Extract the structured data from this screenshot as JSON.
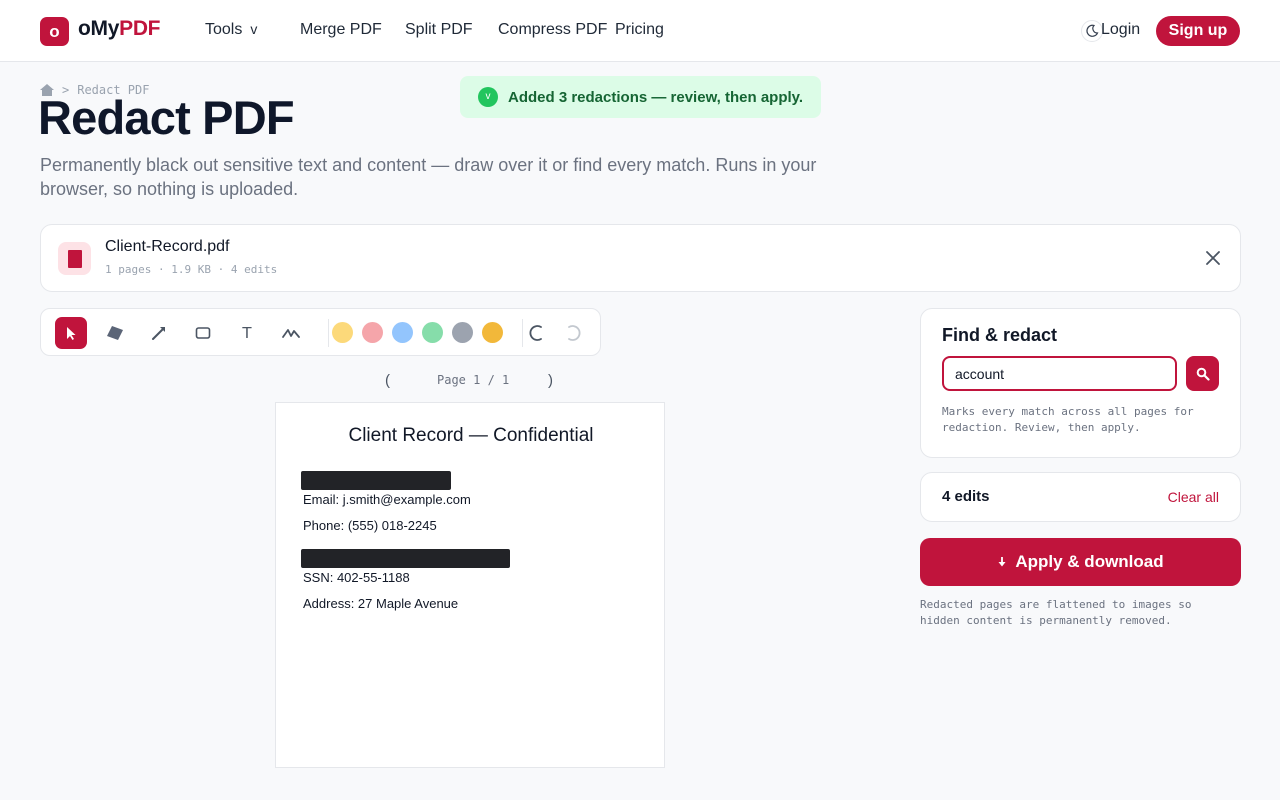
{
  "header": {
    "logo_letter": "o",
    "logo_part1": "oMy",
    "logo_part2": "PDF",
    "nav": {
      "tools": "Tools",
      "tools_chevron": "v",
      "merge": "Merge PDF",
      "split": "Split PDF",
      "compress": "Compress PDF",
      "pricing": "Pricing"
    },
    "login": "Login",
    "signup": "Sign up"
  },
  "breadcrumb": {
    "separator": ">",
    "current": "Redact PDF"
  },
  "page": {
    "title": "Redact PDF",
    "subtitle": "Permanently black out sensitive text and content — draw over it or find every match. Runs in your browser, so nothing is uploaded."
  },
  "toast": {
    "icon": "v",
    "message": "Added 3 redactions — review, then apply."
  },
  "file": {
    "name": "Client-Record.pdf",
    "meta": "1 pages · 1.9 KB · 4 edits"
  },
  "toolbar": {
    "tools": [
      "select-tool",
      "eraser-tool",
      "arrow-tool",
      "rectangle-tool",
      "text-tool",
      "freehand-tool"
    ],
    "text_tool_glyph": "T",
    "colors": [
      "#fcd97a",
      "#f5a5aa",
      "#93c5fd",
      "#86ddaa",
      "#9ca3af",
      "#f2b83a"
    ]
  },
  "pager": {
    "prev": "(",
    "label": "Page 1 / 1",
    "next": ")"
  },
  "document": {
    "title": "Client Record — Confidential",
    "lines": {
      "email": "Email: j.smith@example.com",
      "phone": "Phone: (555) 018-2245",
      "ssn": "SSN: 402-55-1188",
      "address": "Address: 27 Maple Avenue"
    }
  },
  "find": {
    "title": "Find & redact",
    "query": "account",
    "hint": "Marks every match across all pages for redaction. Review, then apply."
  },
  "edits": {
    "count": "4 edits",
    "clear": "Clear all"
  },
  "apply": {
    "label": "Apply & download",
    "note": "Redacted pages are flattened to images so hidden content is permanently removed."
  },
  "colors": {
    "accent": "#c0143c",
    "success_bg": "#dcfce7",
    "success_text": "#166534",
    "redaction": "#222327"
  }
}
